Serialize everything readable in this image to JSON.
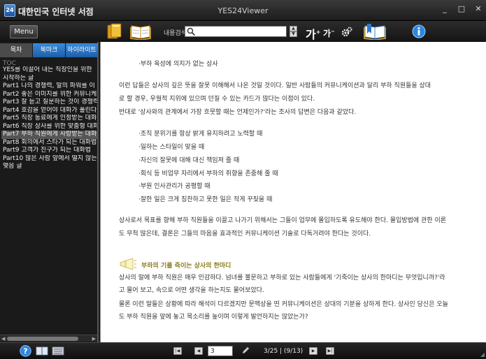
{
  "app": {
    "logo_text": "24",
    "name": "대한민국 인터넷 서점",
    "window_title": "YES24Viewer",
    "window_buttons": [
      "_",
      "□",
      "✕"
    ]
  },
  "toolbar": {
    "menu_label": "Menu",
    "search_label": "내용검색",
    "search_value": "",
    "font_increase_label": "가",
    "font_decrease_label": "가",
    "icons": [
      "library-icon",
      "book-icon",
      "search-icon",
      "settings-icon",
      "bookmark-book-icon",
      "info-icon"
    ]
  },
  "sidebar": {
    "tabs": [
      {
        "label": "목차"
      },
      {
        "label": "북마크"
      },
      {
        "label": "하이라이트"
      }
    ],
    "toc_header": "TOC",
    "toc_items": [
      "YES를 이끌어 내는 직장인을 위한",
      "시작하는 글",
      "Part1 나의 경쟁력, 말의 파워를 이",
      "Part2 좋은 이미지를 위한 커뮤니케",
      "Part3 잘 듣고 질문하는 것이 경쟁력",
      "Part4 호감을 얻어야 대화가 풀린다",
      "Part5 직장 동료에게 인정받는 대화",
      "Part6 직장 상사를 위한 맞춤형 대화",
      "Part7 부하 직원에게 사랑받는 대화",
      "Part8 회의에서 스타가 되는 대화법",
      "Part9 고객가 친구가 되는 대화법",
      "Part10 많은 사람 앞에서 떨지 않는",
      "맺음 글"
    ],
    "selected_index": 8
  },
  "document": {
    "bullet_heading": "·부하 육성에 의지가 없는 상사",
    "para1_lines": [
      "이런 답들은 상사의 깊은 뜻을 잘못 이해해서 나온 것일 것이다. 일반 사람들의 커뮤니케이션과 달리 부하 직원들을 상대",
      "로 할 경우, 우월적 지위에 있으며 던질 수 있는 카드가 많다는 이점이 있다.",
      "반대로 '상사와의 관계에서 가장 흐뭇할 때는 언제인가?'라는 조사의 답변은 다음과 같았다."
    ],
    "list_items": [
      "·조직 분위기를 항상 밝게 유지하려고 노력할 때",
      "·일하는 스타일이 맞을 때",
      "·자신의 잘못에 대해 대신 책임져 줄 때",
      "·회식 등 비업무 자리에서 부하의 취향을 존중해 줄 때",
      "·부원 인사관리가 공평할 때",
      "·잘한 일은 크게 칭찬하고 못한 일은 작게 꾸짖을 때"
    ],
    "para2_lines": [
      "상사로서 목표를 향해 부하 직원들을 이끌고 나가기 위해서는 그들이 업무에 몰입하도록 유도해야 한다. 몰입방법에 관한 이론",
      "도 무척 많은데, 결론은 그들의 마음을 효과적인 커뮤니케이션 기술로 다독거려야 한다는 것이다."
    ],
    "section_title": "부하의 기를 죽이는 상사의 한마디",
    "para3_lines": [
      "상사의 말에 부하 직원은 매우 민감하다. 넘녀를 불문하고 부하로 있는 사람들에게 '기죽이는 상사의 한마디는 무엇입니까?'라",
      "고 물어 보고, 속으로 어떤 생각을 하는지도 물어보았다.",
      "물론 이런 말들은 상황에 따라 해석이 다르겠지만 문맥상을 띤 커뮤니케이션은 상대의 기분을 상하게 한다. 상사인 당신은 오늘",
      "도 부하 직원을 앞에 놓고 목소리를 높이며 이렇게 발언하지는 않았는가?"
    ]
  },
  "statusbar": {
    "current_page": "3",
    "page_status": "3/25 | (9/13)",
    "nav_buttons": [
      "first-page",
      "prev-page",
      "next-page",
      "last-page"
    ]
  },
  "colors": {
    "accent_blue": "#2f7ad0",
    "section_title": "#8b7d1e",
    "doc_text": "#333333"
  }
}
